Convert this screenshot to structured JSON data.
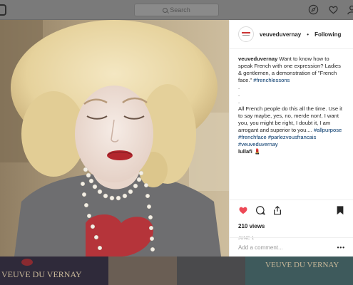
{
  "header": {
    "search_placeholder": "Search",
    "icons": [
      "instagram-logo-icon",
      "compass-icon",
      "heart-icon",
      "user-icon"
    ]
  },
  "post": {
    "username": "veuveduvernay",
    "separator": "•",
    "follow_status": "Following",
    "caption_user": "veuveduvernay",
    "caption_text": " Want to know how to speak French with one expression? Ladies & gentlemen, a demonstration of \"French face.\" ",
    "caption_tag1": "#frenchlessons",
    "dots": ".",
    "body_text": "All French people do this all the time. Use it to say maybe, yes, no, merde non!, I want you, you might be right, I doubt it, I am arrogant and superior to you.... ",
    "tag_allpurpose": "#allpurpose",
    "tag_frenchface": "#frenchface",
    "tag_parlez": "#parlezvousfrancais",
    "tag_brand": "#veuveduvernay",
    "comment_user": "lullafi",
    "comment_text": " 💄",
    "views": "210 views",
    "date": "JUNE 1",
    "add_comment_placeholder": "Add a comment...",
    "more": "•••"
  },
  "strip": {
    "brand_left": "VEUVE DU VERNAY",
    "brand_right": "VEUVE DU VERNAY"
  },
  "colors": {
    "hashtag": "#003569",
    "like_red": "#ed4956",
    "overlay": "#6e6e6e"
  }
}
